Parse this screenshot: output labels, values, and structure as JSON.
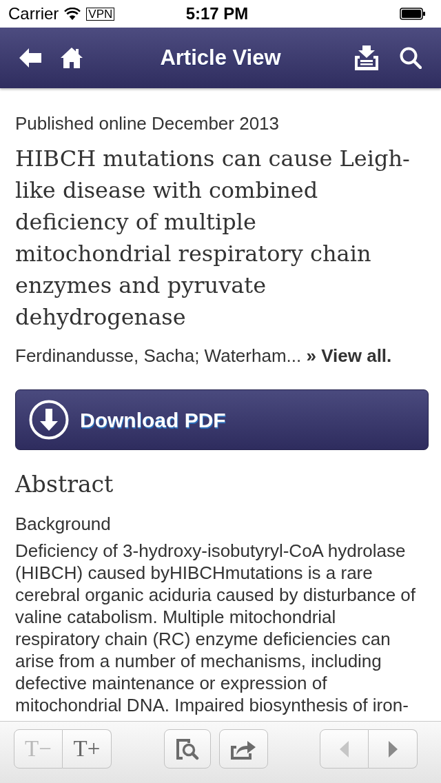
{
  "status_bar": {
    "carrier": "Carrier",
    "vpn": "VPN",
    "time": "5:17 PM"
  },
  "nav_bar": {
    "title": "Article View"
  },
  "article": {
    "published": "Published online December 2013",
    "title": "HIBCH mutations can cause Leigh-like disease with combined deficiency of multiple mitochondrial respiratory chain enzymes and pyruvate dehydrogenase",
    "authors": "Ferdinandusse, Sacha; Waterham...",
    "view_all": "» View all.",
    "download_button": "Download PDF"
  },
  "abstract": {
    "heading": "Abstract",
    "subheading": "Background",
    "text": "Deficiency of 3-hydroxy-isobutyryl-CoA hydrolase (HIBCH) caused byHIBCHmutations is a rare cerebral organic aciduria caused by disturbance of valine catabolism. Multiple mitochondrial respiratory chain (RC) enzyme deficiencies can arise from a number of mechanisms, including defective maintenance or expression of mitochondrial DNA. Impaired biosynthesis of iron-"
  },
  "toolbar": {
    "text_buttons": [
      {
        "label": "T−",
        "disabled": true
      },
      {
        "label": "T+",
        "disabled": false
      }
    ],
    "nav_buttons": [
      {
        "kind": "previous",
        "disabled": true
      },
      {
        "kind": "next",
        "disabled": false
      }
    ]
  }
}
